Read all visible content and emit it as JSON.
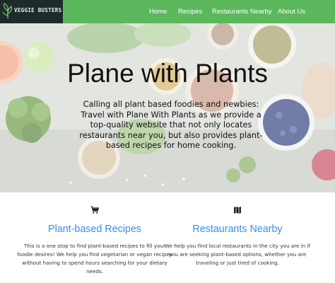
{
  "brand": {
    "logo_text": "VEGGIE BUSTERS"
  },
  "nav": {
    "items": [
      {
        "label": "Home"
      },
      {
        "label": "Recipes"
      },
      {
        "label": "Restaurants Nearby"
      },
      {
        "label": "About Us"
      }
    ]
  },
  "hero": {
    "title": "Plane with Plants",
    "text": "Calling all plant based foodies and newbies: Travel with Plane With Plants as we provide a top-quality website that not only locates restaurants near you, but also provides plant-based recipes for home cooking."
  },
  "features": [
    {
      "icon": "cart-icon",
      "title": "Plant-based Recipes",
      "text": "This is a one stop to find plant-based recipes to fill your foodie desires! We help you find vegetarian or vegan recipes without having to spend hours searching for your dietary needs."
    },
    {
      "icon": "map-icon",
      "title": "Restaurants Nearby",
      "text": "We help you find local restaurants in the city you are in if you are seeking plant-based options, whether you are traveling or just tired of cooking."
    }
  ],
  "colors": {
    "nav_bg": "#5cb85c",
    "logo_bg": "#1f2b2a",
    "feature_title": "#3a8dde"
  }
}
